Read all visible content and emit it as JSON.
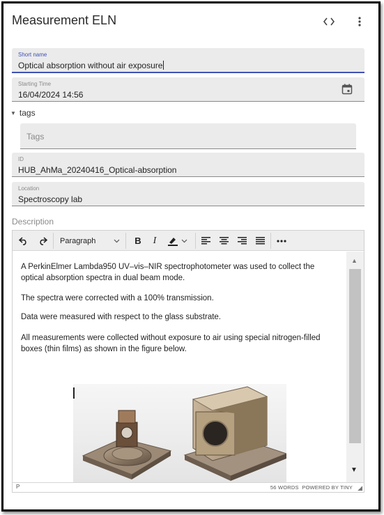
{
  "header": {
    "title": "Measurement ELN",
    "code_icon": "code-icon",
    "more_icon": "more-vert-icon"
  },
  "fields": {
    "short_name": {
      "label": "Short name",
      "value": "Optical absorption without air exposure"
    },
    "starting_time": {
      "label": "Starting Time",
      "value": "16/04/2024 14:56",
      "icon": "calendar-icon"
    },
    "tags": {
      "toggle_label": "tags",
      "placeholder": "Tags"
    },
    "id": {
      "label": "ID",
      "value": "HUB_AhMa_20240416_Optical-absorption"
    },
    "location": {
      "label": "Location",
      "value": "Spectroscopy lab"
    }
  },
  "description": {
    "label": "Description",
    "toolbar": {
      "block_format": "Paragraph"
    },
    "paragraphs": [
      "A PerkinElmer Lambda950 UV–vis–NIR spectrophotometer was used to collect the optical absorption spectra in dual beam mode.",
      "The spectra were corrected with a 100% transmission.",
      "Data were measured with respect to the glass substrate.",
      "All measurements were collected without exposure to air using special nitrogen-filled boxes (thin films) as shown in the figure below."
    ],
    "status": {
      "path": "P",
      "word_count": "56 WORDS",
      "powered_by": "POWERED BY TINY"
    }
  }
}
